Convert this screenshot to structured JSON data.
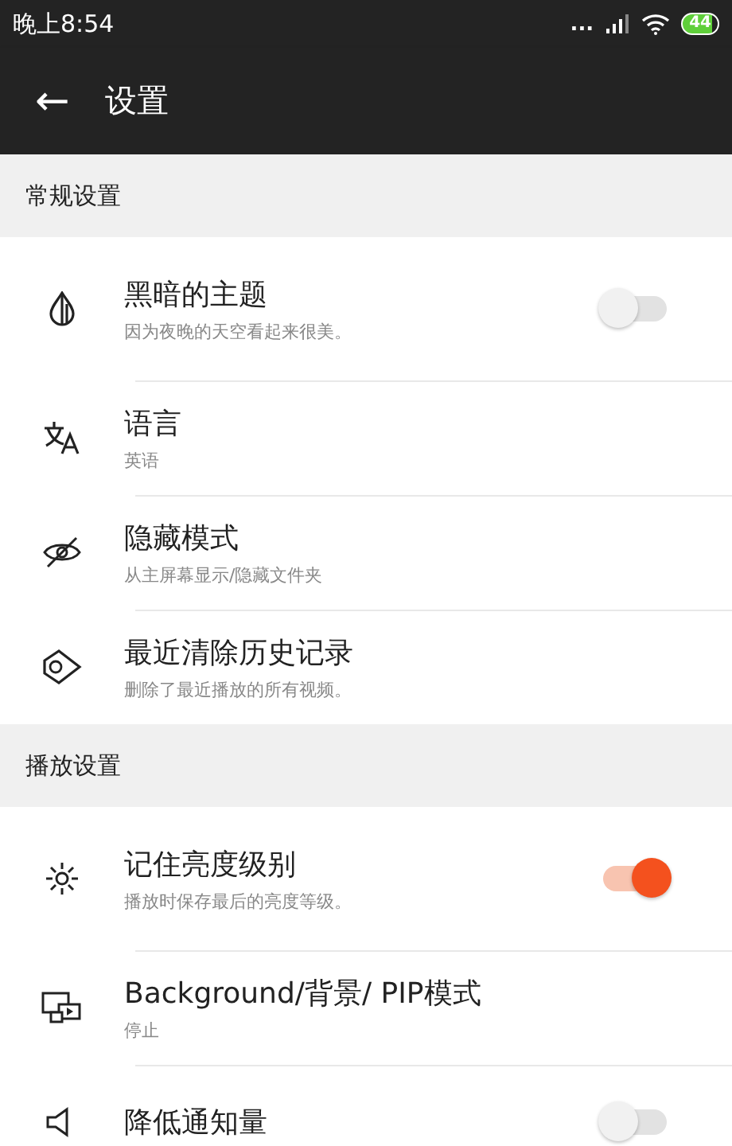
{
  "status_bar": {
    "time": "晚上8:54",
    "signal": "...",
    "battery": "44"
  },
  "toolbar": {
    "back": "←",
    "title": "设置"
  },
  "sections": [
    {
      "title": "常规设置",
      "items": [
        {
          "kind": "toggle",
          "title": "黑暗的主题",
          "subtitle": "因为夜晚的天空看起来很美。",
          "on": false
        },
        {
          "kind": "plain",
          "title": "语言",
          "subtitle": "英语"
        },
        {
          "kind": "plain",
          "title": "隐藏模式",
          "subtitle": "从主屏幕显示/隐藏文件夹"
        },
        {
          "kind": "plain",
          "title": "最近清除历史记录",
          "subtitle": "删除了最近播放的所有视频。"
        }
      ]
    },
    {
      "title": "播放设置",
      "items": [
        {
          "kind": "toggle",
          "title": "记住亮度级别",
          "subtitle": "播放时保存最后的亮度等级。",
          "on": true
        },
        {
          "kind": "plain",
          "title": "Background/背景/ PIP模式",
          "subtitle": "停止"
        },
        {
          "kind": "toggle",
          "title": "降低通知量",
          "on": false
        }
      ]
    }
  ]
}
